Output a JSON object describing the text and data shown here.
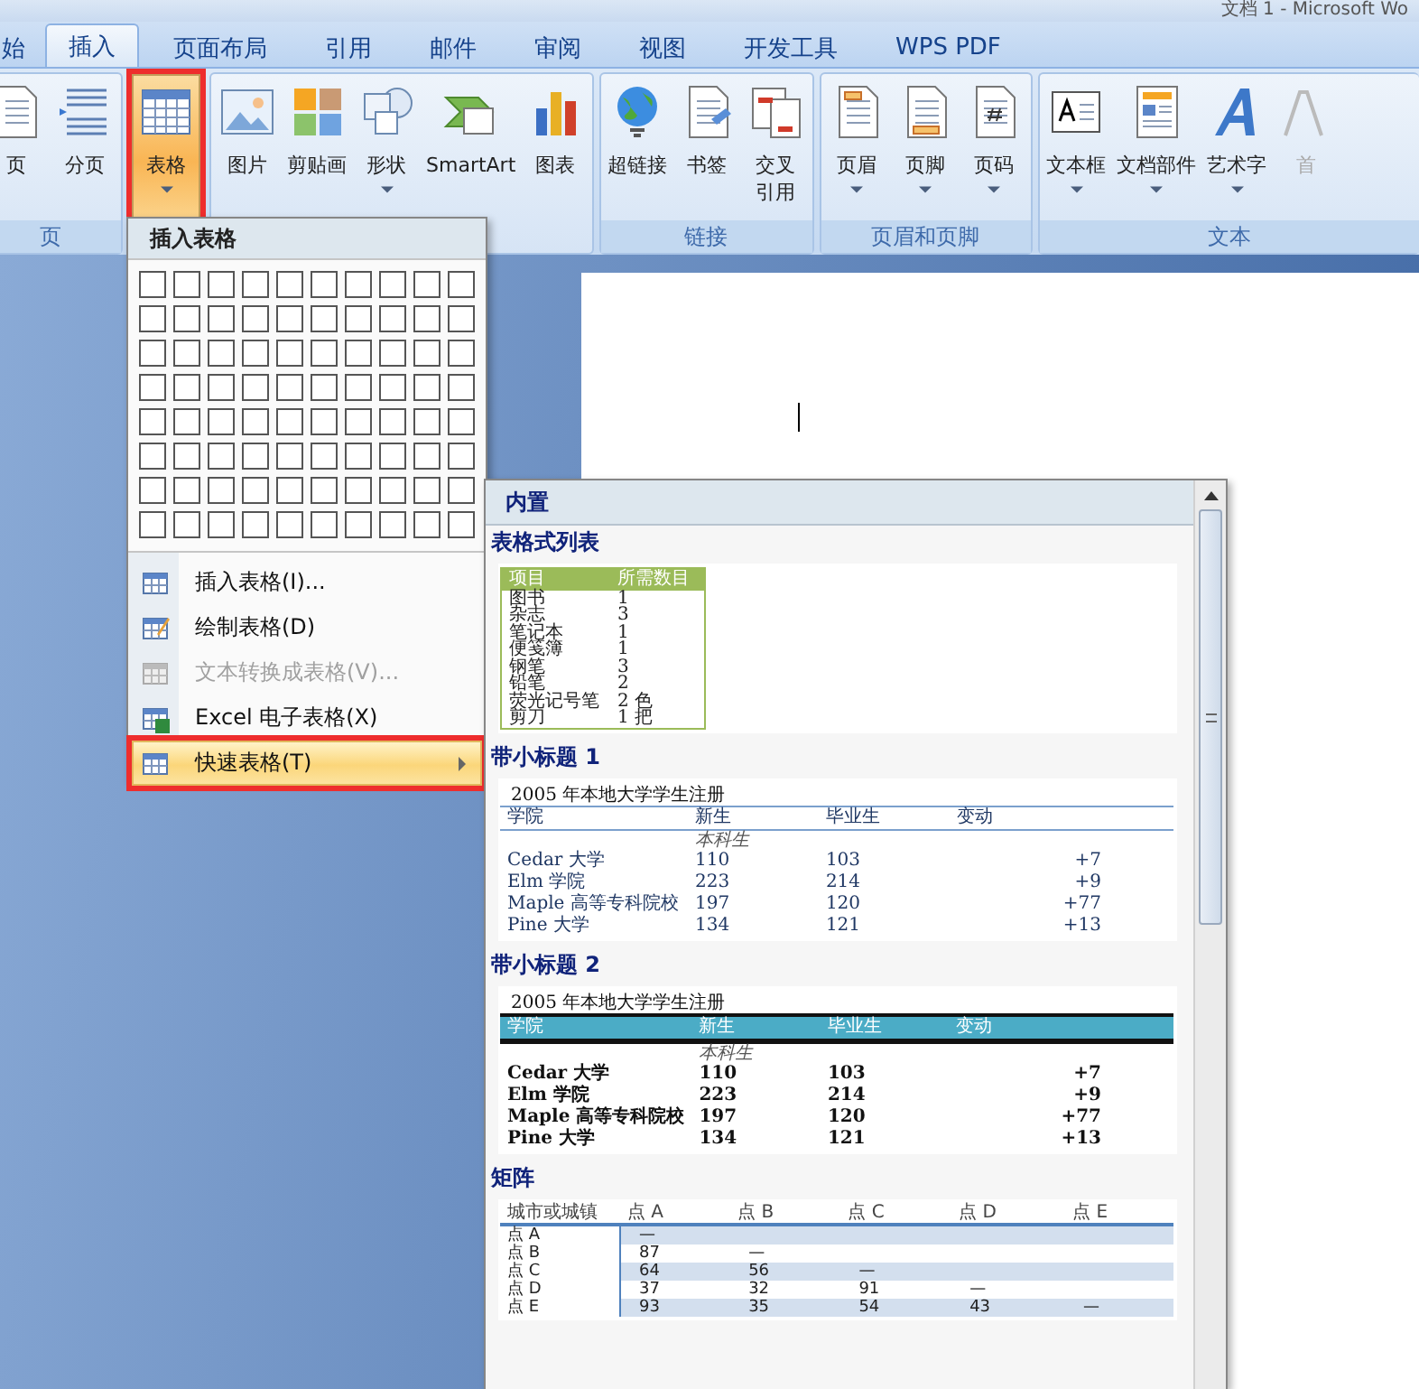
{
  "window": {
    "title": "文档 1 - Microsoft Wo"
  },
  "tabs": [
    {
      "label": "始",
      "selected": false
    },
    {
      "label": "插入",
      "selected": true
    },
    {
      "label": "页面布局",
      "selected": false
    },
    {
      "label": "引用",
      "selected": false
    },
    {
      "label": "邮件",
      "selected": false
    },
    {
      "label": "审阅",
      "selected": false
    },
    {
      "label": "视图",
      "selected": false
    },
    {
      "label": "开发工具",
      "selected": false
    },
    {
      "label": "WPS PDF",
      "selected": false
    }
  ],
  "ribbon": {
    "groups": [
      {
        "label": "页",
        "buttons": [
          {
            "label": "页",
            "dropdown": false,
            "active": false,
            "disabled": false,
            "annotated": false
          },
          {
            "label": "分页",
            "dropdown": false,
            "active": false,
            "disabled": false,
            "annotated": false
          }
        ]
      },
      {
        "buttons": [
          {
            "label": "表格",
            "dropdown": true,
            "active": true,
            "disabled": false,
            "annotated": true
          }
        ]
      },
      {
        "buttons": [
          {
            "label": "图片",
            "dropdown": false,
            "active": false,
            "disabled": false,
            "annotated": false
          },
          {
            "label": "剪贴画",
            "dropdown": false,
            "active": false,
            "disabled": false,
            "annotated": false
          },
          {
            "label": "形状",
            "dropdown": true,
            "active": false,
            "disabled": false,
            "annotated": false
          },
          {
            "label": "SmartArt",
            "dropdown": false,
            "active": false,
            "disabled": false,
            "annotated": false
          },
          {
            "label": "图表",
            "dropdown": false,
            "active": false,
            "disabled": false,
            "annotated": false
          }
        ]
      },
      {
        "label": "链接",
        "buttons": [
          {
            "label": "超链接",
            "dropdown": false,
            "active": false,
            "disabled": false,
            "annotated": false
          },
          {
            "label": "书签",
            "dropdown": false,
            "active": false,
            "disabled": false,
            "annotated": false
          },
          {
            "label": "交叉引用",
            "dropdown": false,
            "active": false,
            "disabled": false,
            "annotated": false
          }
        ]
      },
      {
        "label": "页眉和页脚",
        "buttons": [
          {
            "label": "页眉",
            "dropdown": true,
            "active": false,
            "disabled": false,
            "annotated": false
          },
          {
            "label": "页脚",
            "dropdown": true,
            "active": false,
            "disabled": false,
            "annotated": false
          },
          {
            "label": "页码",
            "dropdown": true,
            "active": false,
            "disabled": false,
            "annotated": false
          }
        ]
      },
      {
        "label": "文本",
        "buttons": [
          {
            "label": "文本框",
            "dropdown": true,
            "active": false,
            "disabled": false,
            "annotated": false
          },
          {
            "label": "文档部件",
            "dropdown": true,
            "active": false,
            "disabled": false,
            "annotated": false
          },
          {
            "label": "艺术字",
            "dropdown": true,
            "active": false,
            "disabled": false,
            "annotated": false
          },
          {
            "label": "首",
            "dropdown": false,
            "active": false,
            "disabled": true,
            "annotated": false
          }
        ]
      }
    ]
  },
  "menu": {
    "title": "插入表格",
    "items": [
      {
        "label": "插入表格(I)...",
        "disabled": false,
        "selected": false,
        "submenu": false,
        "annotated": false
      },
      {
        "label": "绘制表格(D)",
        "disabled": false,
        "selected": false,
        "submenu": false,
        "annotated": false
      },
      {
        "label": "文本转换成表格(V)...",
        "disabled": true,
        "selected": false,
        "submenu": false,
        "annotated": false
      },
      {
        "label": "Excel 电子表格(X)",
        "disabled": false,
        "selected": false,
        "submenu": false,
        "annotated": false
      },
      {
        "label": "快速表格(T)",
        "disabled": false,
        "selected": true,
        "submenu": true,
        "annotated": true
      }
    ]
  },
  "gallery": {
    "header": "内置",
    "sections": [
      {
        "title": "表格式列表",
        "kind": "list",
        "columns": [
          "项目",
          "所需数目"
        ],
        "rows": [
          [
            "图书",
            "1"
          ],
          [
            "杂志",
            "3"
          ],
          [
            "笔记本",
            "1"
          ],
          [
            "便笺簿",
            "1"
          ],
          [
            "钢笔",
            "3"
          ],
          [
            "铅笔",
            "2"
          ],
          [
            "荧光记号笔",
            "2 色"
          ],
          [
            "剪刀",
            "1 把"
          ]
        ]
      },
      {
        "title": "带小标题 1",
        "kind": "subheads-plain",
        "caption": "2005 年本地大学学生注册",
        "columns": [
          "学院",
          "新生",
          "毕业生",
          "变动"
        ],
        "subheading": "本科生",
        "rows": [
          [
            "Cedar 大学",
            "110",
            "103",
            "+7"
          ],
          [
            "Elm 学院",
            "223",
            "214",
            "+9"
          ],
          [
            "Maple 高等专科院校",
            "197",
            "120",
            "+77"
          ],
          [
            "Pine 大学",
            "134",
            "121",
            "+13"
          ]
        ]
      },
      {
        "title": "带小标题 2",
        "kind": "subheads-banded",
        "caption": "2005 年本地大学学生注册",
        "columns": [
          "学院",
          "新生",
          "毕业生",
          "变动"
        ],
        "subheading": "本科生",
        "rows": [
          [
            "Cedar 大学",
            "110",
            "103",
            "+7"
          ],
          [
            "Elm 学院",
            "223",
            "214",
            "+9"
          ],
          [
            "Maple 高等专科院校",
            "197",
            "120",
            "+77"
          ],
          [
            "Pine 大学",
            "134",
            "121",
            "+13"
          ]
        ]
      },
      {
        "title": "矩阵",
        "kind": "matrix",
        "columns": [
          "城市或城镇",
          "点 A",
          "点 B",
          "点 C",
          "点 D",
          "点 E"
        ],
        "rows": [
          [
            "点 A",
            "—"
          ],
          [
            "点 B",
            "87",
            "—"
          ],
          [
            "点 C",
            "64",
            "56",
            "—"
          ],
          [
            "点 D",
            "37",
            "32",
            "91",
            "—"
          ],
          [
            "点 E",
            "93",
            "35",
            "54",
            "43",
            "—"
          ]
        ]
      }
    ]
  }
}
